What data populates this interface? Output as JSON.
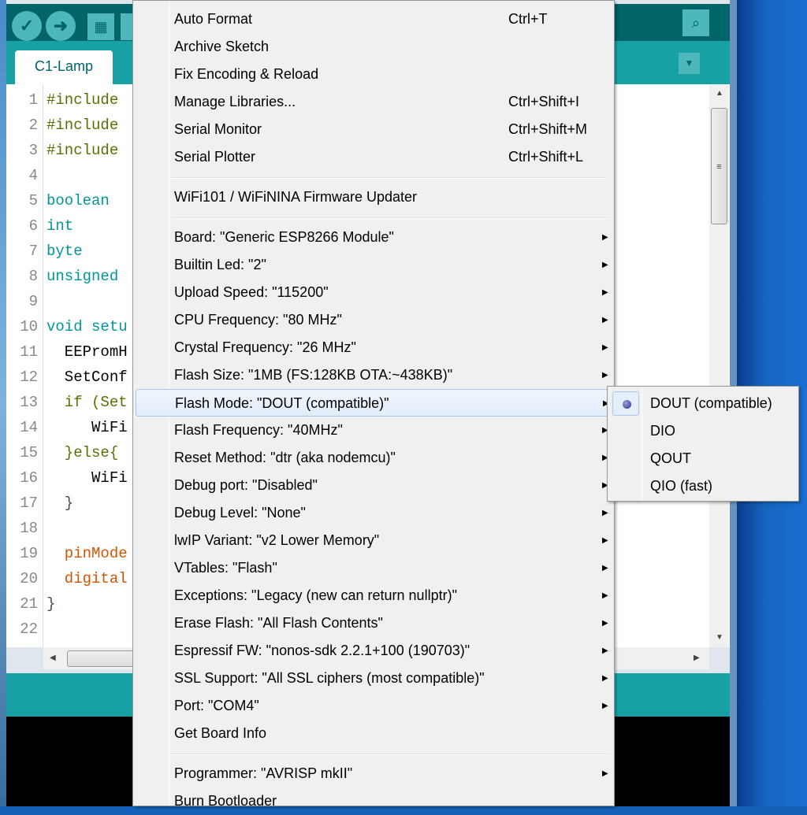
{
  "window": {
    "tab": "C1-Lamp"
  },
  "toolbar": {
    "verify": "✓",
    "upload": "➜",
    "new": "▦",
    "serial_monitor": "⌕"
  },
  "editor": {
    "lines": [
      {
        "n": "1",
        "t": "#include",
        "c": "#5e6d03"
      },
      {
        "n": "2",
        "t": "#include",
        "c": "#5e6d03"
      },
      {
        "n": "3",
        "t": "#include",
        "c": "#5e6d03"
      },
      {
        "n": "4",
        "t": "",
        "c": "#000"
      },
      {
        "n": "5",
        "t": "boolean",
        "c": "#00979c"
      },
      {
        "n": "6",
        "t": "int",
        "c": "#00979c"
      },
      {
        "n": "7",
        "t": "byte",
        "c": "#00979c"
      },
      {
        "n": "8",
        "t": "unsigned",
        "c": "#00979c"
      },
      {
        "n": "9",
        "t": "",
        "c": "#000"
      },
      {
        "n": "10",
        "t": "void setu",
        "c": "#00979c"
      },
      {
        "n": "11",
        "t": "  EEPromH",
        "c": "#000"
      },
      {
        "n": "12",
        "t": "  SetConf",
        "c": "#000"
      },
      {
        "n": "13",
        "t": "  if (Set",
        "c": "#5e6d03"
      },
      {
        "n": "14",
        "t": "     WiFi",
        "c": "#000"
      },
      {
        "n": "15",
        "t": "  }else{",
        "c": "#5e6d03"
      },
      {
        "n": "16",
        "t": "     WiFi",
        "c": "#000"
      },
      {
        "n": "17",
        "t": "  }",
        "c": "#434f54"
      },
      {
        "n": "18",
        "t": "",
        "c": "#000"
      },
      {
        "n": "19",
        "t": "  pinMode",
        "c": "#d35400"
      },
      {
        "n": "20",
        "t": "  digital",
        "c": "#d35400"
      },
      {
        "n": "21",
        "t": "}",
        "c": "#434f54"
      },
      {
        "n": "22",
        "t": "",
        "c": "#000"
      }
    ]
  },
  "menu": {
    "items": [
      {
        "label": "Auto Format",
        "shortcut": "Ctrl+T"
      },
      {
        "label": "Archive Sketch",
        "shortcut": ""
      },
      {
        "label": "Fix Encoding & Reload",
        "shortcut": ""
      },
      {
        "label": "Manage Libraries...",
        "shortcut": "Ctrl+Shift+I"
      },
      {
        "label": "Serial Monitor",
        "shortcut": "Ctrl+Shift+M"
      },
      {
        "label": "Serial Plotter",
        "shortcut": "Ctrl+Shift+L"
      },
      {
        "label": "WiFi101 / WiFiNINA Firmware Updater",
        "shortcut": ""
      },
      {
        "label": "Board: \"Generic ESP8266 Module\"",
        "submenu": true
      },
      {
        "label": "Builtin Led: \"2\"",
        "submenu": true
      },
      {
        "label": "Upload Speed: \"115200\"",
        "submenu": true
      },
      {
        "label": "CPU Frequency: \"80 MHz\"",
        "submenu": true
      },
      {
        "label": "Crystal Frequency: \"26 MHz\"",
        "submenu": true
      },
      {
        "label": "Flash Size: \"1MB (FS:128KB OTA:~438KB)\"",
        "submenu": true
      },
      {
        "label": "Flash Mode: \"DOUT (compatible)\"",
        "submenu": true,
        "highlighted": true
      },
      {
        "label": "Flash Frequency: \"40MHz\"",
        "submenu": true
      },
      {
        "label": "Reset Method: \"dtr (aka nodemcu)\"",
        "submenu": true
      },
      {
        "label": "Debug port: \"Disabled\"",
        "submenu": true
      },
      {
        "label": "Debug Level: \"None\"",
        "submenu": true
      },
      {
        "label": "lwIP Variant: \"v2 Lower Memory\"",
        "submenu": true
      },
      {
        "label": "VTables: \"Flash\"",
        "submenu": true
      },
      {
        "label": "Exceptions: \"Legacy (new can return nullptr)\"",
        "submenu": true
      },
      {
        "label": "Erase Flash: \"All Flash Contents\"",
        "submenu": true
      },
      {
        "label": "Espressif FW: \"nonos-sdk 2.2.1+100 (190703)\"",
        "submenu": true
      },
      {
        "label": "SSL Support: \"All SSL ciphers (most compatible)\"",
        "submenu": true
      },
      {
        "label": "Port: \"COM4\"",
        "submenu": true
      },
      {
        "label": "Get Board Info"
      },
      {
        "label": "Programmer: \"AVRISP mkII\"",
        "submenu": true
      },
      {
        "label": "Burn Bootloader"
      }
    ],
    "submenu_arrow": "▶"
  },
  "flash_mode_submenu": {
    "items": [
      {
        "label": "DOUT (compatible)",
        "selected": true
      },
      {
        "label": "DIO"
      },
      {
        "label": "QOUT"
      },
      {
        "label": "QIO (fast)"
      }
    ]
  },
  "colors": {
    "toolbar": "#006468",
    "tabbar": "#17a1a5",
    "button": "#4db7bb"
  }
}
